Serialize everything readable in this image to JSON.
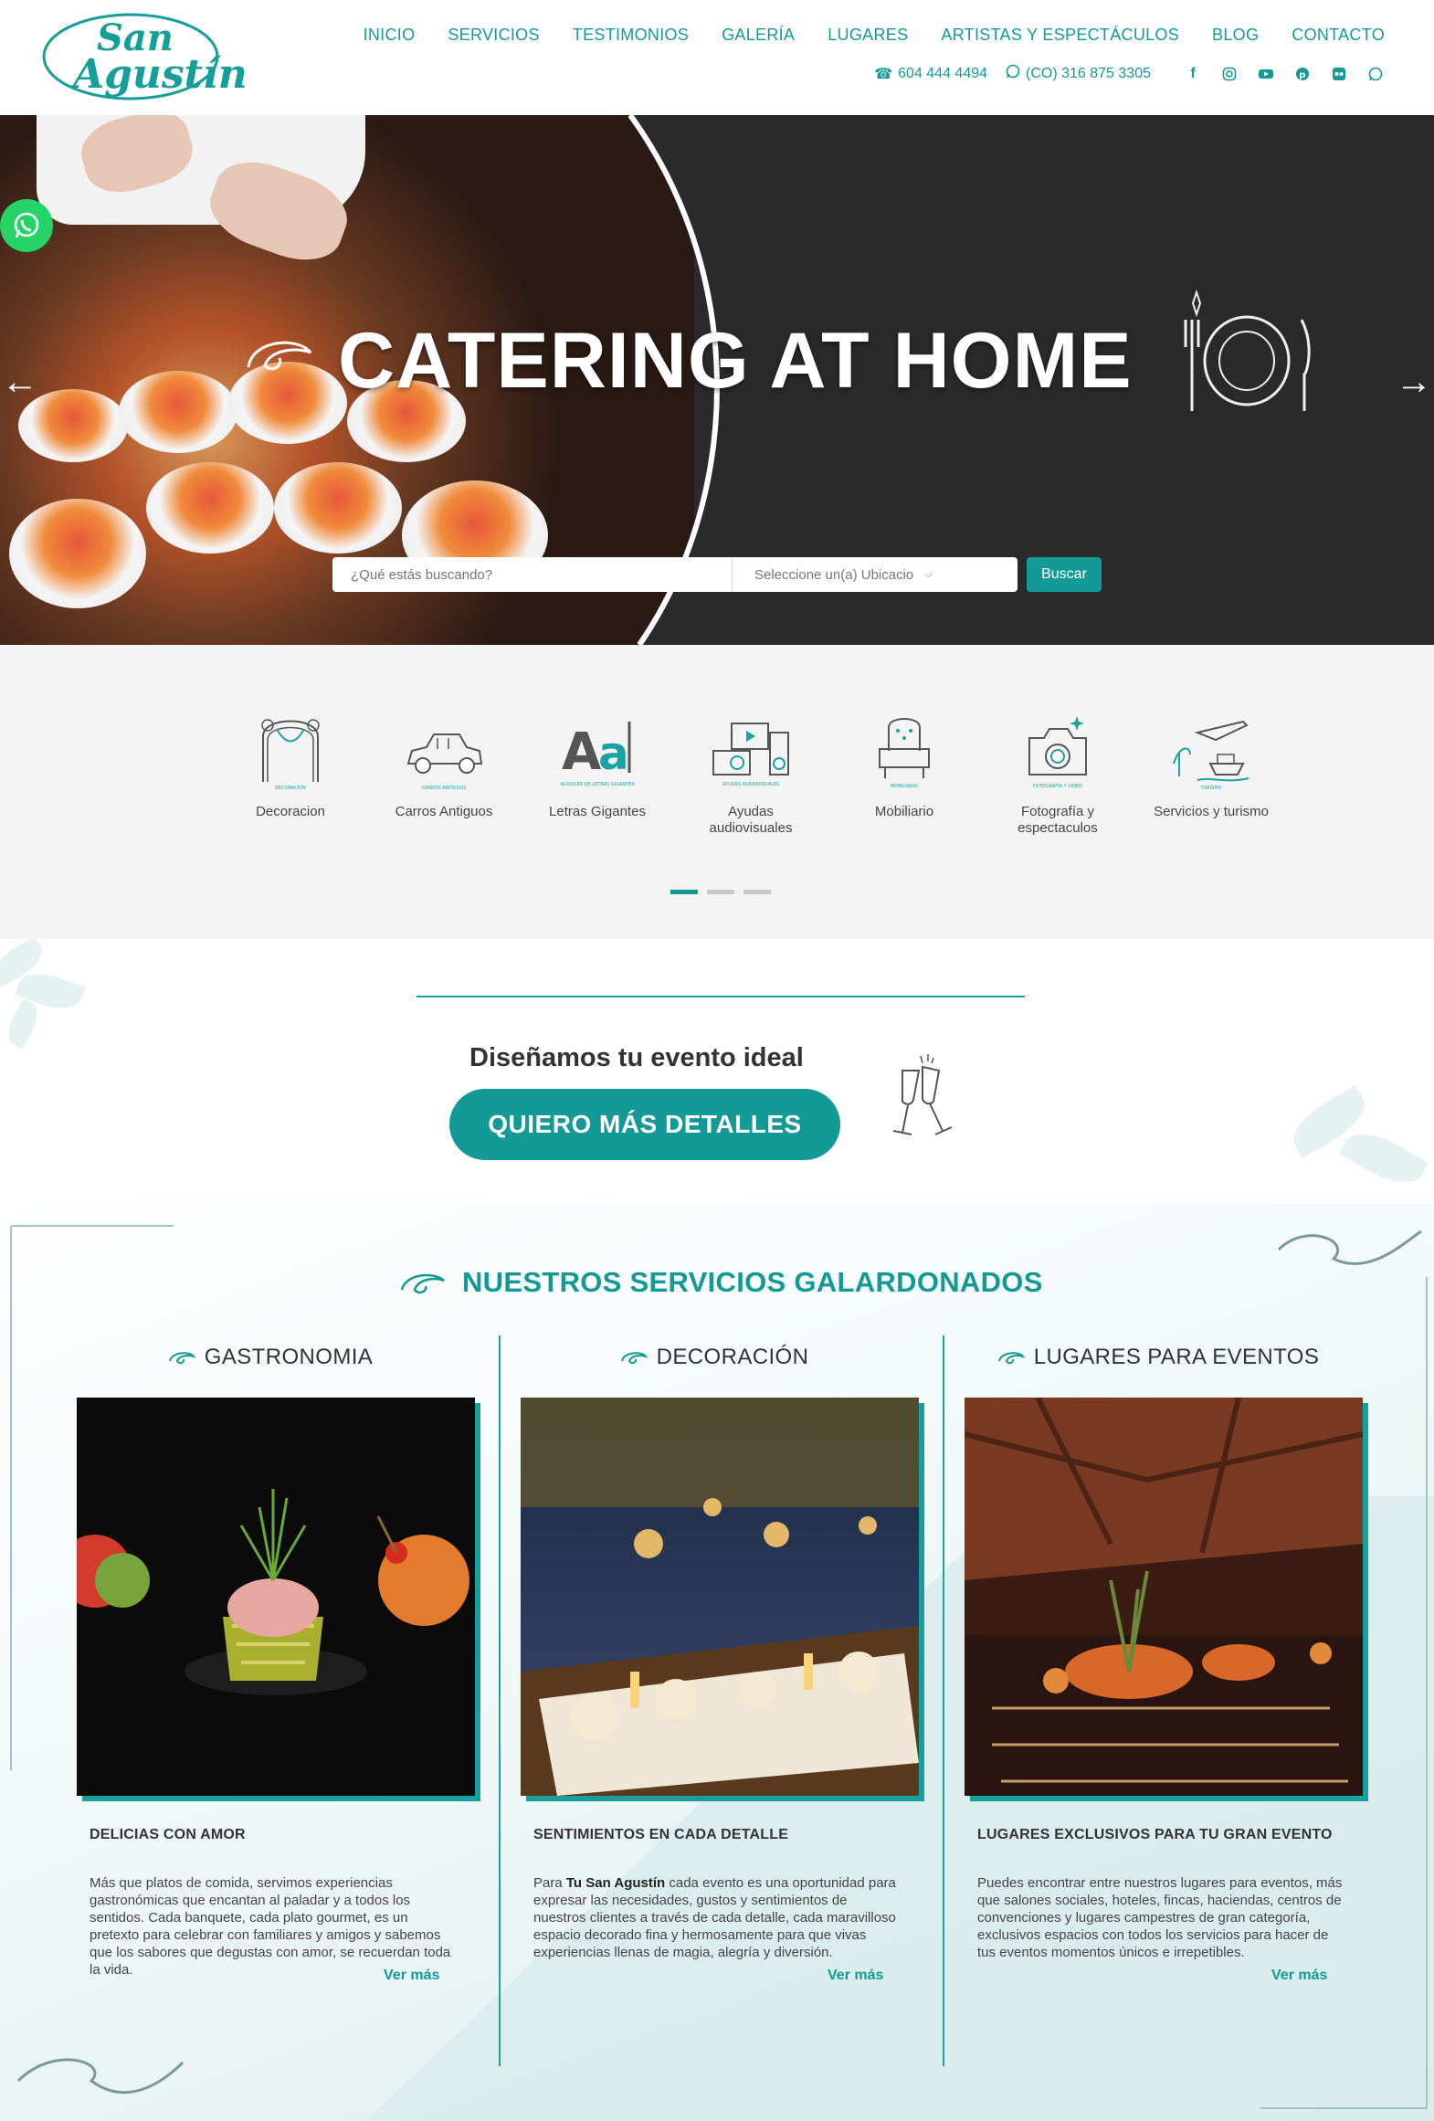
{
  "header": {
    "logo_line1": "San",
    "logo_line2": "Agustín",
    "nav": [
      "INICIO",
      "SERVICIOS",
      "TESTIMONIOS",
      "GALERÍA",
      "LUGARES",
      "ARTISTAS Y ESPECTÁCULOS",
      "BLOG",
      "CONTACTO"
    ],
    "phone": "604 444 4494",
    "whatsapp": "(CO) 316 875 3305",
    "social_icons": [
      "facebook-icon",
      "instagram-icon",
      "youtube-icon",
      "pinterest-icon",
      "flickr-icon",
      "whatsapp-icon"
    ]
  },
  "hero": {
    "title": "CATERING AT HOME",
    "search_placeholder": "¿Qué estás buscando?",
    "location_select": "Seleccione un(a) Ubicacio",
    "search_button": "Buscar"
  },
  "categories": {
    "items": [
      {
        "label": "Decoracion",
        "icon": "decoration-arch-icon",
        "icon_caption": "DECORACIÓN"
      },
      {
        "label": "Carros Antiguos",
        "icon": "vintage-car-icon",
        "icon_caption": "CARROS ANTIGUOS"
      },
      {
        "label": "Letras Gigantes",
        "icon": "giant-letters-icon",
        "icon_caption": "ALQUILER DE LETRAS GIGANTES"
      },
      {
        "label": "Ayudas audiovisuales",
        "icon": "audiovisual-icon",
        "icon_caption": "AYUDAS AUDIOVISUALES"
      },
      {
        "label": "Mobiliario",
        "icon": "armchair-icon",
        "icon_caption": "MOBILIARIO"
      },
      {
        "label": "Fotografía y espectaculos",
        "icon": "camera-icon",
        "icon_caption": "FOTOGRAFÍA Y VIDEO"
      },
      {
        "label": "Servicios y turismo",
        "icon": "travel-icon",
        "icon_caption": "TURISMO"
      }
    ],
    "active_page": 1,
    "page_count": 3
  },
  "cta": {
    "title": "Diseñamos tu evento ideal",
    "button": "QUIERO MÁS DETALLES"
  },
  "services": {
    "title": "NUESTROS SERVICIOS GALARDONADOS",
    "columns": [
      {
        "heading": "GASTRONOMIA",
        "subtitle": "DELICIAS CON AMOR",
        "text": "Más que platos de comida, servimos experiencias gastronómicas que encantan al paladar y a todos los sentidos. Cada banquete, cada plato gourmet, es un pretexto para celebrar con familiares y amigos y sabemos que los sabores que degustas con amor, se recuerdan toda la vida.",
        "more": "Ver más"
      },
      {
        "heading": "DECORACIÓN",
        "subtitle": "SENTIMIENTOS EN CADA DETALLE",
        "text_prefix": "Para ",
        "text_bold": "Tu San Agustín",
        "text": " cada evento es una oportunidad para expresar las necesidades, gustos y sentimientos de nuestros clientes a través de cada detalle, cada maravilloso espacio decorado fina y hermosamente para que vivas experiencias llenas de magia, alegría y diversión.",
        "more": "Ver más"
      },
      {
        "heading": "LUGARES PARA EVENTOS",
        "subtitle": "LUGARES EXCLUSIVOS PARA TU GRAN EVENTO",
        "text": "Puedes encontrar entre nuestros lugares para eventos, más que salones sociales, hoteles, fincas, haciendas, centros de convenciones y lugares campestres de gran categoría, exclusivos espacios con todos los servicios para hacer de tus eventos momentos únicos e irrepetibles.",
        "more": "Ver más"
      }
    ]
  },
  "colors": {
    "accent": "#139a96",
    "hero_dark": "#2a2a2a",
    "category_bg": "#f4f4f4"
  }
}
